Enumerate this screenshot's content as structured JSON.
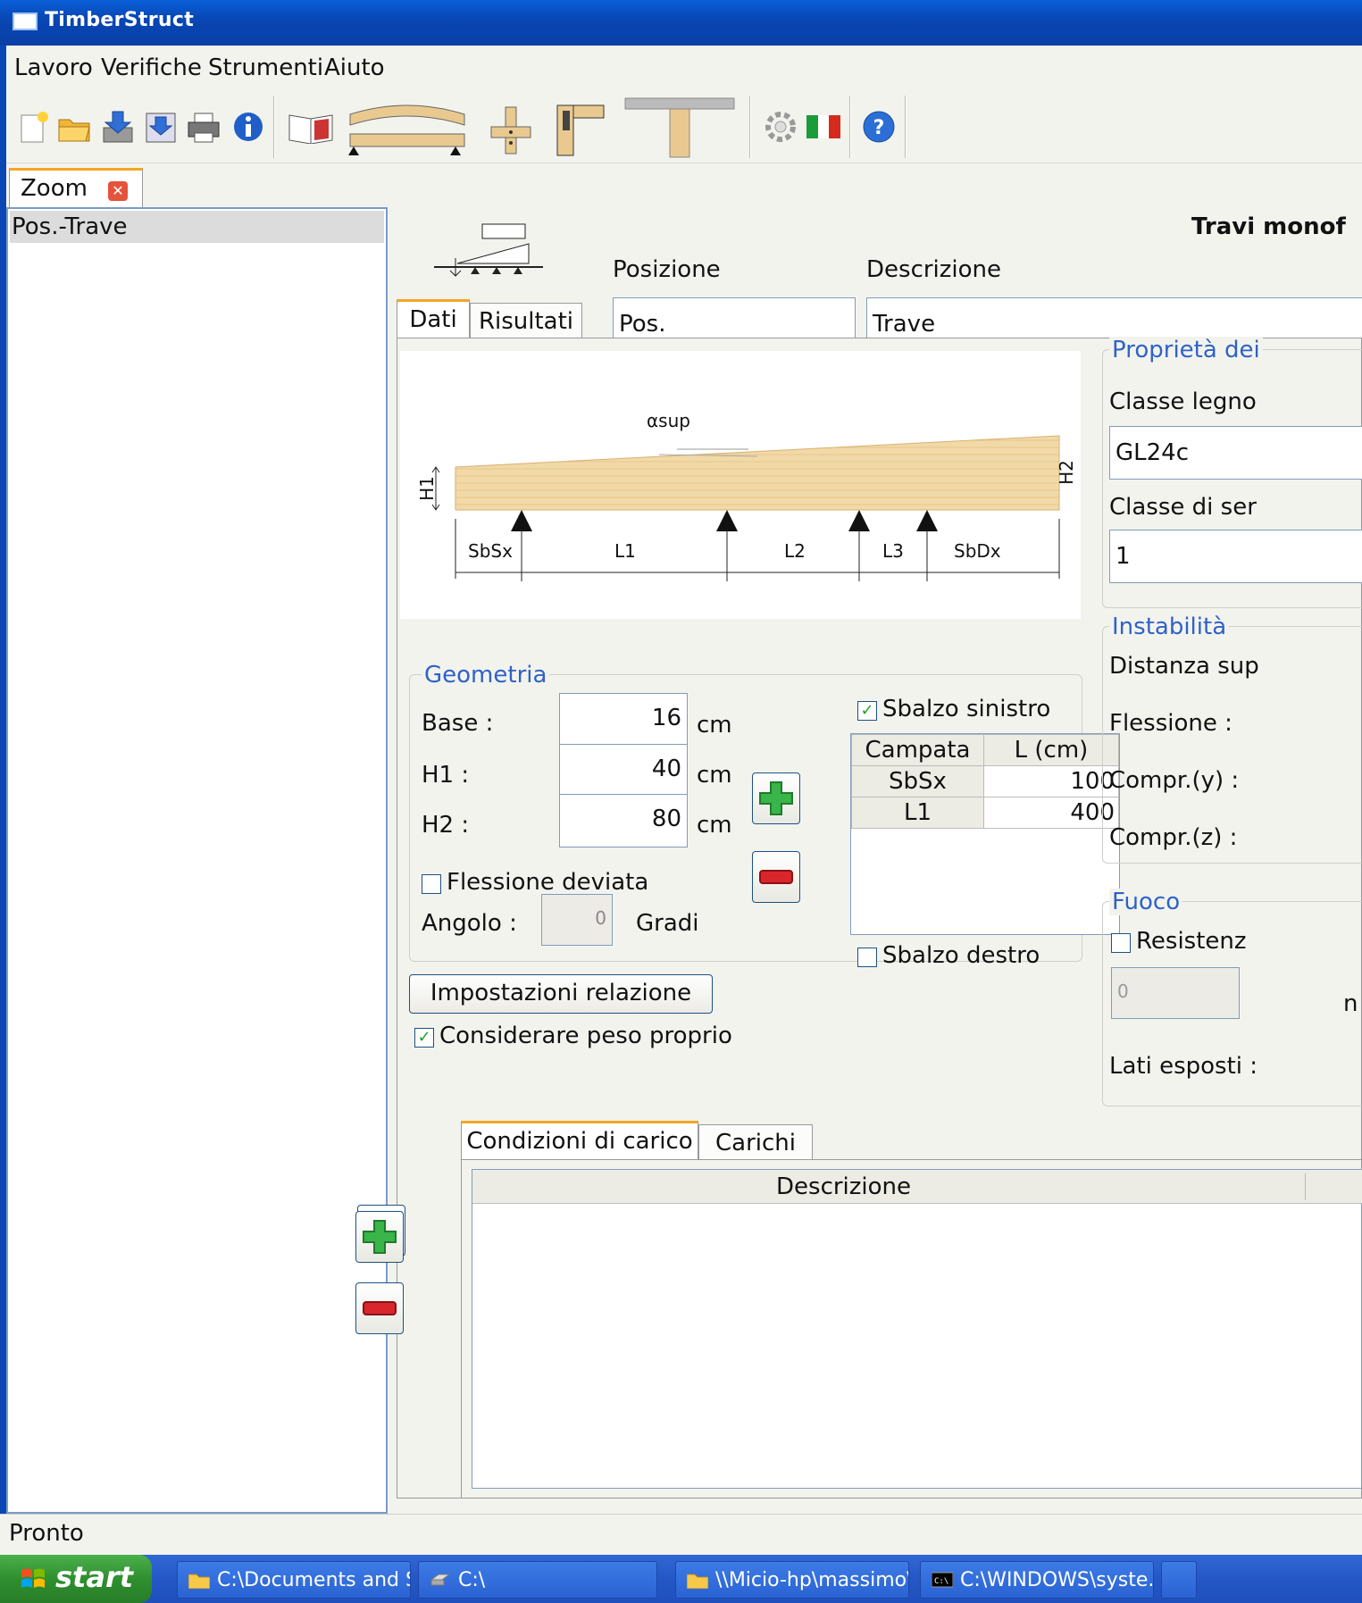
{
  "window": {
    "title": "TimberStruct"
  },
  "menu": [
    "Lavoro",
    "Verifiche",
    "Strumenti",
    "Aiuto"
  ],
  "toolbar": {
    "icons": [
      "new-icon",
      "open-icon",
      "save-icon",
      "save-as-icon",
      "print-icon",
      "info-icon",
      "manual-icon",
      "beam-icon",
      "connection-icon",
      "joint-icon",
      "tbeam-icon",
      "settings-icon",
      "language-flag-icon",
      "help-icon"
    ]
  },
  "zoom": {
    "tab_label": "Zoom",
    "items": [
      "Pos.-Trave"
    ]
  },
  "header": {
    "title": "Travi monof",
    "posizione_label": "Posizione",
    "descrizione_label": "Descrizione",
    "posizione_value": "Pos.",
    "descrizione_value": "Trave"
  },
  "tabs": {
    "dati": "Dati",
    "risultati": "Risultati"
  },
  "diagram": {
    "alpha": "αsup",
    "h1": "H1",
    "h2": "H2",
    "spans": [
      "SbSx",
      "L1",
      "L2",
      "L3",
      "SbDx"
    ]
  },
  "geometria": {
    "title": "Geometria",
    "base_label": "Base :",
    "base_value": "16",
    "h1_label": "H1 :",
    "h1_value": "40",
    "h2_label": "H2 :",
    "h2_value": "80",
    "unit": "cm",
    "flessione_deviata": "Flessione deviata",
    "angolo_label": "Angolo :",
    "angolo_value": "0",
    "gradi": "Gradi",
    "sbalzo_sinistro": "Sbalzo sinistro",
    "sbalzo_destro": "Sbalzo destro",
    "table_headers": [
      "Campata",
      "L (cm)"
    ],
    "table_rows": [
      [
        "SbSx",
        "100"
      ],
      [
        "L1",
        "400"
      ]
    ]
  },
  "impostazioni_button": "Impostazioni relazione",
  "peso_proprio": "Considerare peso proprio",
  "proprieta": {
    "title": "Proprietà dei",
    "classe_legno_label": "Classe legno",
    "classe_legno_value": "GL24c",
    "classe_servizio_label": "Classe di ser",
    "classe_servizio_value": "1"
  },
  "instabilita": {
    "title": "Instabilità",
    "distanza": "Distanza sup",
    "flessione": "Flessione :",
    "compr_y": "Compr.(y) :",
    "compr_z": "Compr.(z) :"
  },
  "fuoco": {
    "title": "Fuoco",
    "resistenza": "Resistenz",
    "value": "0",
    "unit": "n",
    "lati": "Lati esposti :"
  },
  "load_tabs": {
    "condizioni": "Condizioni di carico",
    "carichi": "Carichi"
  },
  "load_table": {
    "header": "Descrizione"
  },
  "status": "Pronto",
  "taskbar": {
    "start": "start",
    "items": [
      "C:\\Documents and Se...",
      "C:\\",
      "\\\\Micio-hp\\massimo\\T...",
      "C:\\WINDOWS\\syste..."
    ]
  },
  "colors": {
    "accent_blue": "#2e62c8",
    "tab_highlight": "#f5a623",
    "titlebar": "#0a5fd8"
  }
}
